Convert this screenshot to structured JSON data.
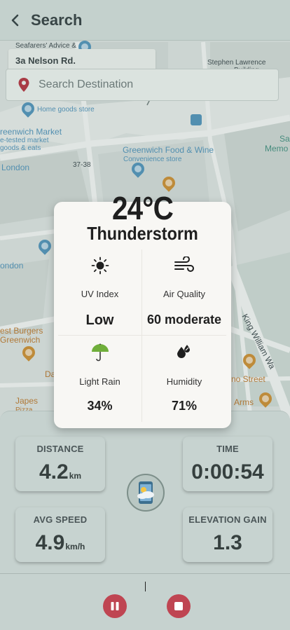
{
  "header": {
    "title": "Search"
  },
  "search": {
    "address": "3a Nelson Rd.",
    "placeholder": "Search Destination"
  },
  "map_labels": {
    "seafarers": "Seafarers' Advice &",
    "stephen": "Stephen Lawrence",
    "building": "Building",
    "home_goods": "Home goods store",
    "greenwich_market": "reenwich Market",
    "tested_market": "e-tested market",
    "goods_eats": "goods & eats",
    "food_wine": "Greenwich Food & Wine",
    "convenience": "Convenience store",
    "london": "London",
    "london2": "ondon",
    "num": "37-38",
    "best_burgers": "est Burgers",
    "greenwich": "Greenwich",
    "japes": "Japes",
    "pizza": "Pizza",
    "da": "Da",
    "king_william": "King William Wa",
    "no_street": "no Street",
    "arms": "Arms",
    "sa": "Sa",
    "memo": "Memo"
  },
  "weather": {
    "temperature": "24°C",
    "condition": "Thunderstorm",
    "uv_label": "UV Index",
    "uv_value": "Low",
    "air_label": "Air Quality",
    "air_value": "60 moderate",
    "rain_label": "Light Rain",
    "rain_value": "34%",
    "humidity_label": "Humidity",
    "humidity_value": "71%"
  },
  "stats": {
    "distance_label": "DISTANCE",
    "distance_value": "4.2",
    "distance_unit": "km",
    "time_label": "TIME",
    "time_value": "0:00:54",
    "speed_label": "AVG SPEED",
    "speed_value": "4.9",
    "speed_unit": "km/h",
    "elevation_label": "ELEVATION GAIN",
    "elevation_value": "1.3"
  },
  "colors": {
    "accent": "#bf4552",
    "pin": "#b0303d"
  }
}
